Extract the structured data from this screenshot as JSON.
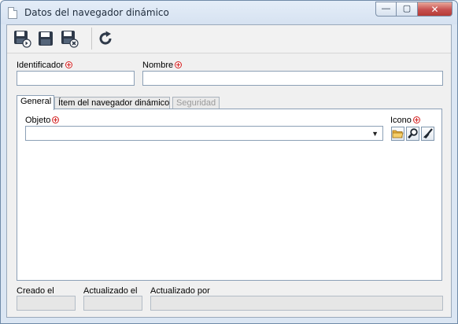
{
  "window": {
    "title": "Datos del navegador dinámico",
    "minimize_glyph": "—",
    "maximize_glyph": "▢",
    "close_glyph": "✕"
  },
  "toolbar": {
    "buttons": [
      {
        "name": "save-new-button",
        "icon": "floppy-add-icon"
      },
      {
        "name": "save-button",
        "icon": "floppy-icon"
      },
      {
        "name": "save-close-button",
        "icon": "floppy-close-icon"
      },
      {
        "name": "refresh-button",
        "icon": "refresh-icon"
      }
    ]
  },
  "form": {
    "identificador_label": "Identificador",
    "identificador_value": "",
    "nombre_label": "Nombre",
    "nombre_value": ""
  },
  "tabs": [
    {
      "label": "General",
      "active": true
    },
    {
      "label": "Ítem del navegador dinámico",
      "active": false
    },
    {
      "label": "Seguridad",
      "active": false,
      "disabled": true
    }
  ],
  "general": {
    "objeto_label": "Objeto",
    "objeto_value": "",
    "icono_label": "Icono",
    "icon_buttons": [
      "folder-icon",
      "search-icon",
      "brush-icon"
    ]
  },
  "footer": {
    "creado_label": "Creado el",
    "actualizado_label": "Actualizado el",
    "actualizado_por_label": "Actualizado por",
    "creado_value": "",
    "actualizado_value": "",
    "actualizado_por_value": ""
  },
  "colors": {
    "required": "#d42020",
    "title_bar": "#dbe6f3",
    "close_button": "#c75050"
  }
}
